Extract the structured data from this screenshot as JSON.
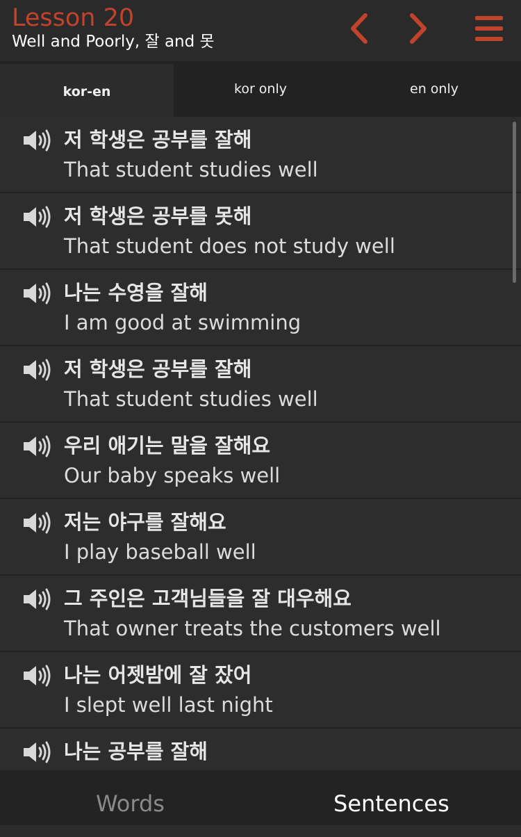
{
  "header": {
    "lesson_title": "Lesson 20",
    "lesson_subtitle": "Well and Poorly, 잘 and 못",
    "prev_icon": "chevron-left-icon",
    "next_icon": "chevron-right-icon",
    "menu_icon": "hamburger-menu-icon",
    "accent_color": "#c1432b"
  },
  "tabs": [
    {
      "label": "kor-en",
      "active": true
    },
    {
      "label": "kor only",
      "active": false
    },
    {
      "label": "en only",
      "active": false
    }
  ],
  "sentences": [
    {
      "kor": "저 학생은 공부를 잘해",
      "en": "That student studies well"
    },
    {
      "kor": "저 학생은 공부를 못해",
      "en": "That student does not study well"
    },
    {
      "kor": "나는 수영을 잘해",
      "en": "I am good at swimming"
    },
    {
      "kor": "저 학생은 공부를 잘해",
      "en": "That student studies well"
    },
    {
      "kor": "우리 애기는 말을 잘해요",
      "en": "Our baby speaks well"
    },
    {
      "kor": "저는 야구를 잘해요",
      "en": "I play baseball well"
    },
    {
      "kor": "그 주인은 고객님들을 잘 대우해요",
      "en": "That owner treats the customers well"
    },
    {
      "kor": "나는 어젯밤에 잘 잤어",
      "en": "I slept well last night"
    },
    {
      "kor": "나는 공부를 잘해",
      "en": ""
    }
  ],
  "bottom_nav": {
    "words_label": "Words",
    "sentences_label": "Sentences",
    "active": "Sentences"
  }
}
